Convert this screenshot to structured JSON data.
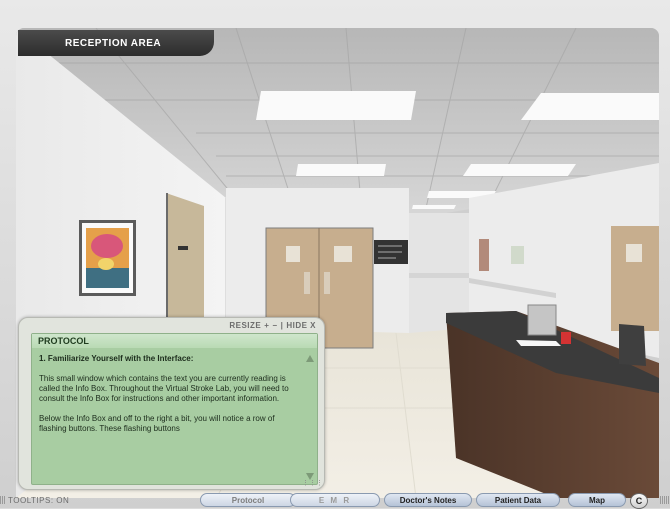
{
  "location": {
    "title": "RECEPTION AREA"
  },
  "infobox": {
    "controls": {
      "resize": "RESIZE",
      "plus": "+",
      "minus": "−",
      "separator": "|",
      "hide": "HIDE X"
    },
    "header": "PROTOCOL",
    "heading": "1. Familiarize Yourself with the Interface:",
    "paragraph1": "This small window which contains the text you are currently reading is called the Info Box. Throughout the Virtual Stroke Lab, you will need to consult the Info Box for instructions and other important information.",
    "paragraph2": "Below the Info Box and off to the right a bit, you will notice a row of flashing buttons. These flashing buttons"
  },
  "bottombar": {
    "tooltips": "TOOLTIPS: ON",
    "buttons": {
      "protocol": "Protocol",
      "emr": "E M R",
      "doctors_notes": "Doctor's Notes",
      "patient_data": "Patient Data",
      "map": "Map",
      "c": "C"
    }
  },
  "colors": {
    "infobox_bg": "#a8cda2",
    "title_bg": "#2c2c2c",
    "reception_desk": "#5b3f2f"
  }
}
